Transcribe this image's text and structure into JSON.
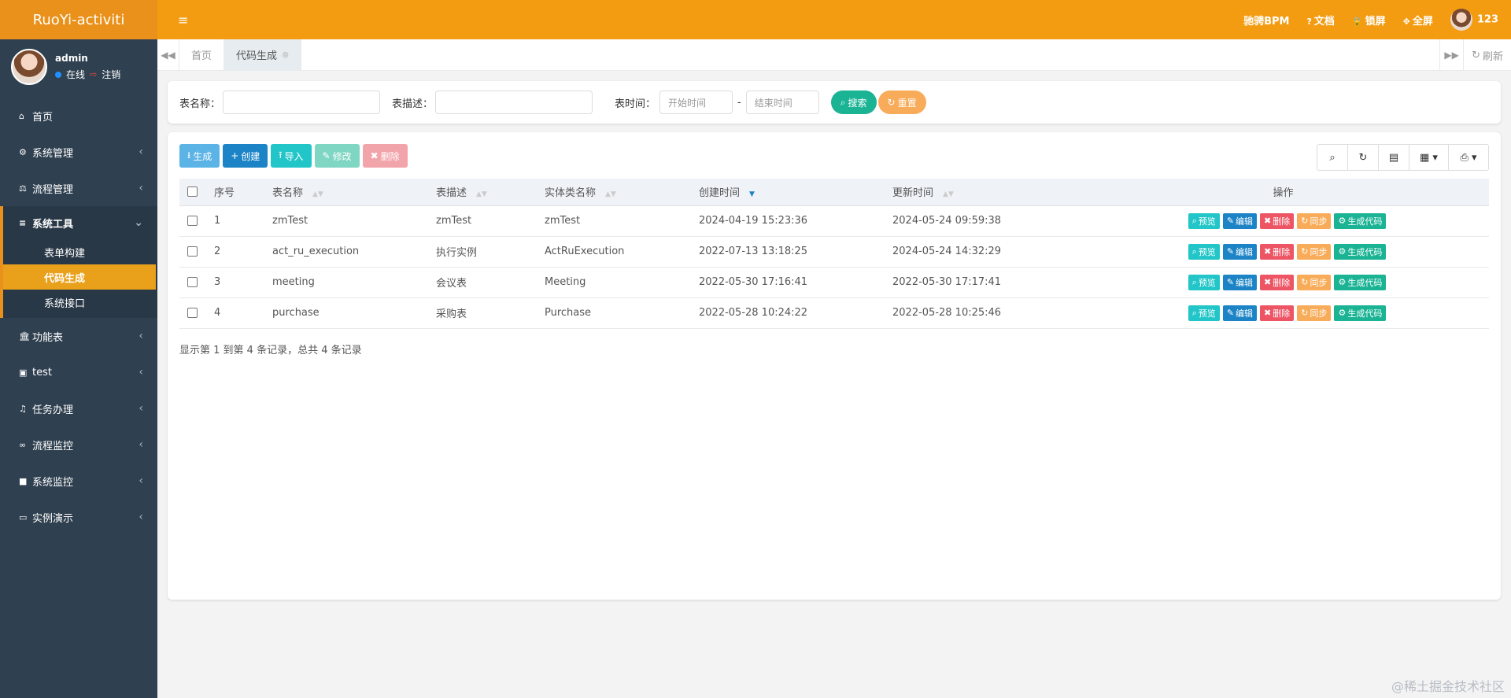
{
  "app": {
    "logo": "RuoYi-activiti"
  },
  "user": {
    "name": "admin",
    "status": "在线",
    "logout": "注销"
  },
  "sidebar": {
    "items": [
      {
        "label": "首页",
        "icon": "home-icon"
      },
      {
        "label": "系统管理",
        "icon": "gear-icon"
      },
      {
        "label": "流程管理",
        "icon": "scale-icon"
      },
      {
        "label": "系统工具",
        "icon": "bars-icon",
        "expanded": true,
        "children": [
          {
            "label": "表单构建"
          },
          {
            "label": "代码生成",
            "active": true
          },
          {
            "label": "系统接口"
          }
        ]
      },
      {
        "label": "功能表",
        "icon": "bank-icon"
      },
      {
        "label": "test",
        "icon": "badge-icon"
      },
      {
        "label": "任务办理",
        "icon": "bell-icon"
      },
      {
        "label": "流程监控",
        "icon": "binoculars-icon"
      },
      {
        "label": "系统监控",
        "icon": "camera-icon"
      },
      {
        "label": "实例演示",
        "icon": "desktop-icon"
      }
    ]
  },
  "topbar": {
    "bpm": "驰骋BPM",
    "docs": "文档",
    "lock": "锁屏",
    "fullscreen": "全屏",
    "username": "123"
  },
  "tabs": {
    "items": [
      {
        "label": "首页"
      },
      {
        "label": "代码生成",
        "active": true
      }
    ],
    "refresh": "刷新"
  },
  "search": {
    "table_name_label": "表名称：",
    "table_desc_label": "表描述：",
    "table_time_label": "表时间：",
    "start_placeholder": "开始时间",
    "end_placeholder": "结束时间",
    "dash": "-",
    "search_btn": "搜索",
    "reset_btn": "重置"
  },
  "toolbar": {
    "generate": "生成",
    "create": "创建",
    "import": "导入",
    "edit": "修改",
    "delete": "删除"
  },
  "table": {
    "headers": [
      "序号",
      "表名称",
      "表描述",
      "实体类名称",
      "创建时间",
      "更新时间",
      "操作"
    ],
    "rows": [
      {
        "no": "1",
        "name": "zmTest",
        "desc": "zmTest",
        "entity": "zmTest",
        "created": "2024-04-19 15:23:36",
        "updated": "2024-05-24 09:59:38"
      },
      {
        "no": "2",
        "name": "act_ru_execution",
        "desc": "执行实例",
        "entity": "ActRuExecution",
        "created": "2022-07-13 13:18:25",
        "updated": "2024-05-24 14:32:29"
      },
      {
        "no": "3",
        "name": "meeting",
        "desc": "会议表",
        "entity": "Meeting",
        "created": "2022-05-30 17:16:41",
        "updated": "2022-05-30 17:17:41"
      },
      {
        "no": "4",
        "name": "purchase",
        "desc": "采购表",
        "entity": "Purchase",
        "created": "2022-05-28 10:24:22",
        "updated": "2022-05-28 10:25:46"
      }
    ],
    "row_actions": [
      "预览",
      "编辑",
      "删除",
      "同步",
      "生成代码"
    ],
    "footer": "显示第 1 到第 4 条记录，总共 4 条记录"
  },
  "watermark": "@稀土掘金技术社区",
  "colors": {
    "topbar": "#f39c12",
    "sidebar": "#2f4050",
    "accent": "#e9a01a",
    "info": "#23c6c8",
    "primary": "#1c84c6",
    "danger": "#ed5565",
    "warning": "#f8ac59",
    "success": "#1ab394"
  }
}
